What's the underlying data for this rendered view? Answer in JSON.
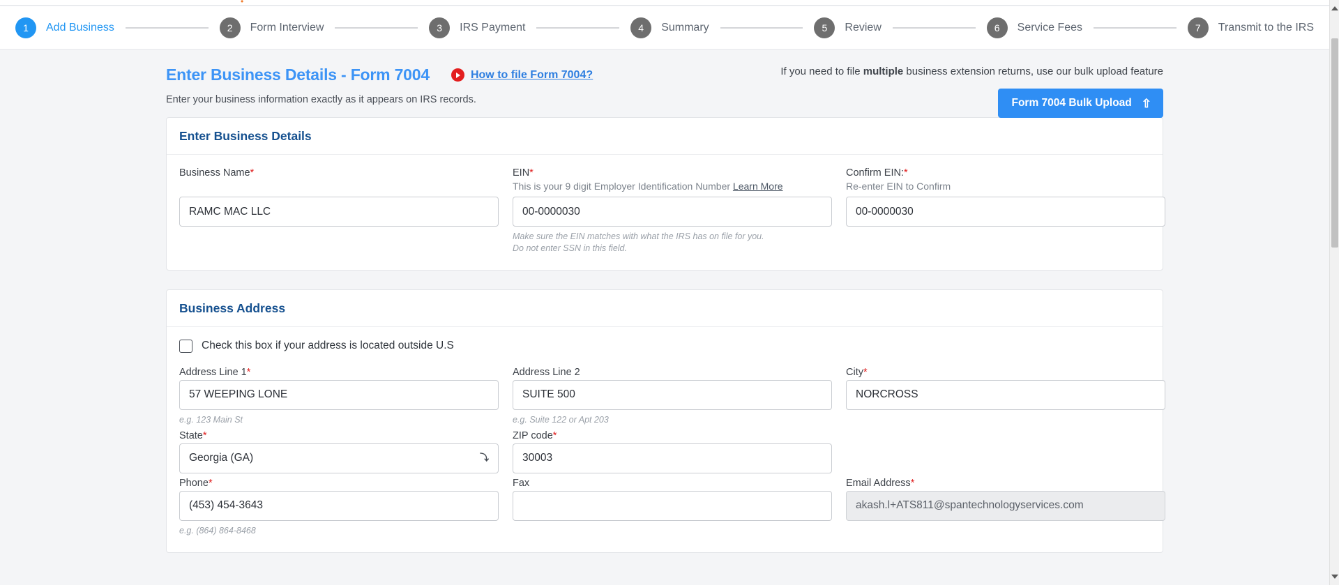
{
  "stepper": {
    "steps": [
      {
        "num": "1",
        "label": "Add Business",
        "active": true
      },
      {
        "num": "2",
        "label": "Form Interview",
        "active": false
      },
      {
        "num": "3",
        "label": "IRS Payment",
        "active": false
      },
      {
        "num": "4",
        "label": "Summary",
        "active": false
      },
      {
        "num": "5",
        "label": "Review",
        "active": false
      },
      {
        "num": "6",
        "label": "Service Fees",
        "active": false
      },
      {
        "num": "7",
        "label": "Transmit to the IRS",
        "active": false
      }
    ]
  },
  "header": {
    "title": "Enter Business Details - Form 7004",
    "video_link": "How to file Form 7004?",
    "video_icon": "youtube-play-icon",
    "subtitle": "Enter your business information exactly as it appears on IRS records.",
    "bulk_note_prefix": "If you need to file ",
    "bulk_note_bold": "multiple",
    "bulk_note_suffix": " business extension returns, use our bulk upload feature",
    "bulk_button_label": "Form 7004 Bulk Upload",
    "bulk_button_icon": "upload-icon",
    "accent_blue": "#2f8ef4",
    "title_blue": "#3d94f6"
  },
  "business_details": {
    "card_title": "Enter Business Details",
    "business_name": {
      "label": "Business Name",
      "required": true,
      "value": "RAMC MAC LLC"
    },
    "ein": {
      "label": "EIN",
      "required": true,
      "help": "This is your 9 digit Employer Identification Number ",
      "help_link": "Learn More",
      "value": "00-0000030",
      "hint_line1": "Make sure the EIN matches with what the IRS has on file for you.",
      "hint_line2": "Do not enter SSN in this field."
    },
    "confirm_ein": {
      "label": "Confirm EIN:",
      "required": true,
      "help": "Re-enter EIN to Confirm",
      "value": "00-0000030"
    }
  },
  "business_address": {
    "card_title": "Business Address",
    "outside_us_checkbox": {
      "label": "Check this box if your address is located outside U.S",
      "checked": false
    },
    "address_line_1": {
      "label": "Address Line 1",
      "required": true,
      "value": "57 WEEPING LONE",
      "hint": "e.g. 123 Main St"
    },
    "address_line_2": {
      "label": "Address Line 2",
      "required": false,
      "value": "SUITE 500",
      "hint": "e.g. Suite 122 or Apt 203"
    },
    "city": {
      "label": "City",
      "required": true,
      "value": "NORCROSS"
    },
    "state": {
      "label": "State",
      "required": true,
      "value": "Georgia (GA)",
      "icon": "chevron-down-icon"
    },
    "zip_code": {
      "label": "ZIP code",
      "required": true,
      "value": "30003"
    },
    "phone": {
      "label": "Phone",
      "required": true,
      "value": "(453) 454-3643",
      "hint": "e.g. (864) 864-8468"
    },
    "fax": {
      "label": "Fax",
      "required": false,
      "value": ""
    },
    "email": {
      "label": "Email Address",
      "required": true,
      "value": "akash.l+ATS811@spantechnologyservices.com",
      "disabled": true
    }
  }
}
